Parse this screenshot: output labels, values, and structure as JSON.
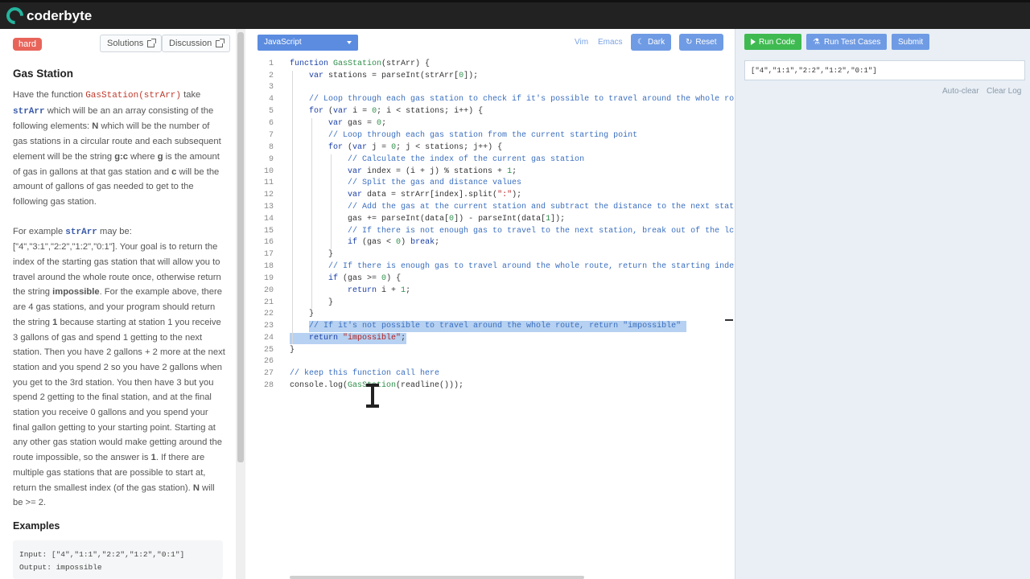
{
  "app": {
    "brand": "coderbyte"
  },
  "challenge": {
    "difficulty": "hard",
    "solutions_label": "Solutions",
    "discussion_label": "Discussion",
    "title": "Gas Station",
    "examples_title": "Examples",
    "example_input": "Input: [\"4\",\"1:1\",\"2:2\",\"1:2\",\"0:1\"]",
    "example_output": "Output: impossible"
  },
  "editor": {
    "language": "JavaScript",
    "vim_label": "Vim",
    "emacs_label": "Emacs",
    "dark_label": "Dark",
    "reset_label": "Reset",
    "line_numbers": [
      "1",
      "2",
      "3",
      "4",
      "5",
      "6",
      "7",
      "8",
      "9",
      "10",
      "11",
      "12",
      "13",
      "14",
      "15",
      "16",
      "17",
      "18",
      "19",
      "20",
      "21",
      "22",
      "23",
      "24",
      "25",
      "26",
      "27",
      "28"
    ]
  },
  "runner": {
    "run_code_label": "Run Code",
    "run_tests_label": "Run Test Cases",
    "submit_label": "Submit",
    "input_value": "[\"4\",\"1:1\",\"2:2\",\"1:2\",\"0:1\"]",
    "auto_clear_label": "Auto-clear",
    "clear_log_label": "Clear Log"
  }
}
